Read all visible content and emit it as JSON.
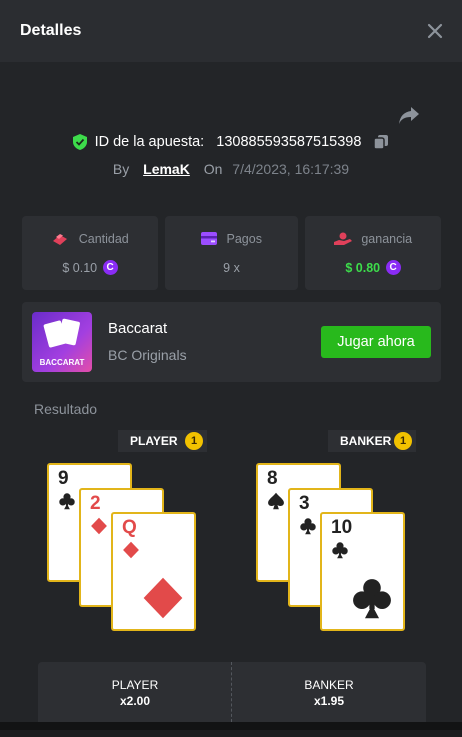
{
  "header": {
    "title": "Detalles"
  },
  "bet": {
    "id_label": "ID de la apuesta:",
    "id_value": "130885593587515398",
    "by_label": "By",
    "username": "LemaK",
    "on_label": "On",
    "date": "7/4/2023, 16:17:39"
  },
  "stats": {
    "amount_label": "Cantidad",
    "amount_value": "$ 0.10",
    "payout_label": "Pagos",
    "payout_value": "9 x",
    "profit_label": "ganancia",
    "profit_value": "$ 0.80",
    "coin_symbol": "C"
  },
  "game": {
    "name": "Baccarat",
    "provider": "BC Originals",
    "thumb_text": "BACCARAT",
    "play_label": "Jugar ahora"
  },
  "result": {
    "label": "Resultado",
    "player": {
      "label": "PLAYER",
      "score": "1",
      "cards": [
        {
          "rank": "9",
          "suit": "club",
          "color": "black"
        },
        {
          "rank": "2",
          "suit": "diamond",
          "color": "red"
        },
        {
          "rank": "Q",
          "suit": "diamond",
          "color": "red"
        }
      ]
    },
    "banker": {
      "label": "BANKER",
      "score": "1",
      "cards": [
        {
          "rank": "8",
          "suit": "spade",
          "color": "black"
        },
        {
          "rank": "3",
          "suit": "club",
          "color": "black"
        },
        {
          "rank": "10",
          "suit": "club",
          "color": "black"
        }
      ]
    }
  },
  "bets": [
    {
      "name": "PLAYER",
      "odds": "x2.00"
    },
    {
      "name": "BANKER",
      "odds": "x1.95"
    }
  ],
  "colors": {
    "accent_green": "#28b91c",
    "profit_green": "#3ddc4b",
    "card_border": "#e2b51a",
    "badge_yellow": "#f2c200",
    "coin_purple": "#8a2cf5",
    "suit_red": "#e24a4a"
  },
  "icons": {
    "close": "close-icon",
    "share": "share-icon",
    "verified": "shield-check-icon",
    "copy": "copy-icon",
    "amount": "bet-chip-icon",
    "payout": "wallet-icon",
    "profit": "hand-coin-icon"
  }
}
